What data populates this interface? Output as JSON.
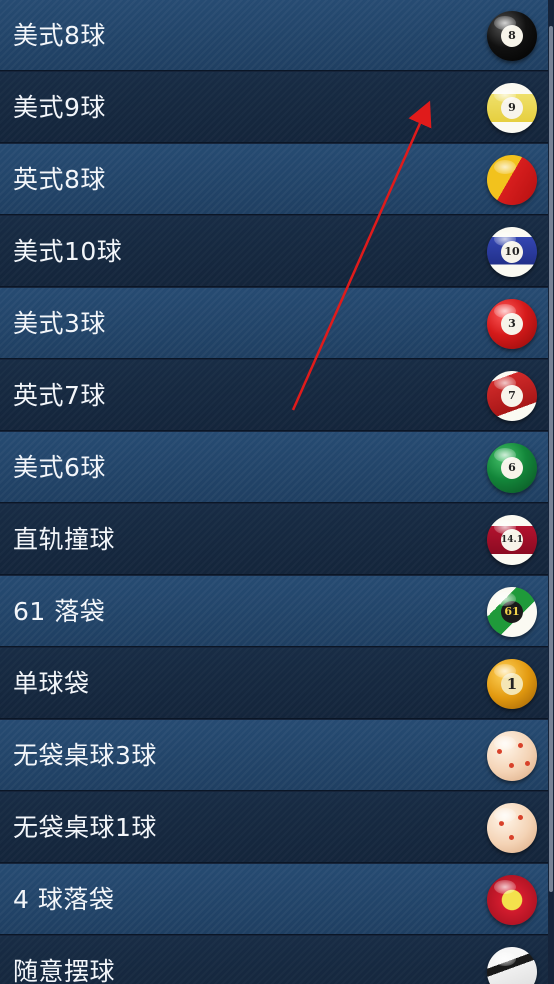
{
  "items": [
    {
      "label": "美式8球",
      "ball": "eight-ball-icon",
      "color": "#111111"
    },
    {
      "label": "美式9球",
      "ball": "nine-ball-icon",
      "color": "#f2e37a"
    },
    {
      "label": "英式8球",
      "ball": "red-yellow-ball-icon",
      "color": "#d81e1e"
    },
    {
      "label": "美式10球",
      "ball": "ten-ball-icon",
      "color": "#2b3a9c"
    },
    {
      "label": "美式3球",
      "ball": "three-ball-icon",
      "color": "#d51a1a"
    },
    {
      "label": "英式7球",
      "ball": "seven-ball-icon",
      "color": "#d12a2a"
    },
    {
      "label": "美式6球",
      "ball": "six-ball-icon",
      "color": "#13863a"
    },
    {
      "label": "直轨撞球",
      "ball": "straight-rail-ball-icon",
      "color": "#b3122e"
    },
    {
      "label": "61 落袋",
      "ball": "sixty-one-ball-icon",
      "color": "#1f9a3a"
    },
    {
      "label": "单球袋",
      "ball": "one-ball-icon",
      "color": "#e39a10"
    },
    {
      "label": "无袋桌球3球",
      "ball": "carom-dotted-ball-icon",
      "color": "#f4d3b5"
    },
    {
      "label": "无袋桌球1球",
      "ball": "carom-dotted-ball-icon",
      "color": "#f4d3b5"
    },
    {
      "label": "4 球落袋",
      "ball": "red-yellow-target-ball-icon",
      "color": "#d31c2e"
    },
    {
      "label": "随意摆球",
      "ball": "white-black-ball-icon",
      "color": "#f2f2f2"
    }
  ],
  "ball_numbers": {
    "eight": "8",
    "nine": "9",
    "ten": "10",
    "three": "3",
    "seven": "7",
    "six": "6",
    "straight": "14.1",
    "sixty_one": "61",
    "one": "1"
  },
  "annotation": {
    "arrow_color": "#e01b1b"
  }
}
